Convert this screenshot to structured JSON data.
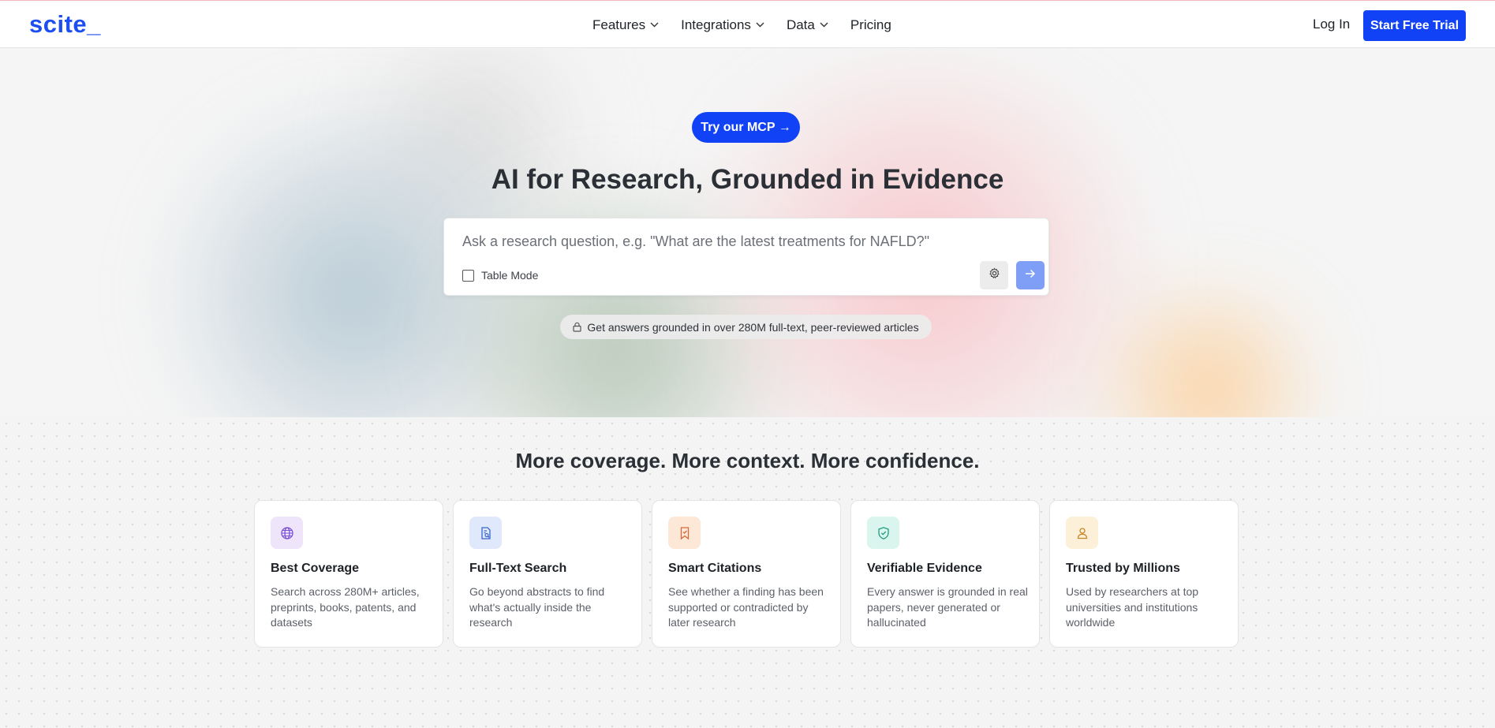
{
  "header": {
    "logo": "scite_",
    "nav": [
      {
        "label": "Features",
        "has_dropdown": true
      },
      {
        "label": "Integrations",
        "has_dropdown": true
      },
      {
        "label": "Data",
        "has_dropdown": true
      },
      {
        "label": "Pricing",
        "has_dropdown": false
      }
    ],
    "login_label": "Log In",
    "trial_label": "Start Free Trial"
  },
  "hero": {
    "mcp_button": "Try our MCP →",
    "title": "AI for Research, Grounded in Evidence",
    "search_placeholder": "Ask a research question, e.g. \"What are the latest treatments for NAFLD?\"",
    "table_mode_label": "Table Mode",
    "table_mode_checked": false,
    "info_pill": "Get answers grounded in over 280M full-text, peer-reviewed articles"
  },
  "features": {
    "title": "More coverage. More context. More confidence.",
    "cards": [
      {
        "icon": "globe-icon",
        "title": "Best Coverage",
        "desc": "Search across 280M+ articles, preprints, books, patents, and datasets",
        "icon_bg": "#efe5fb",
        "icon_color": "#7b4fd6"
      },
      {
        "icon": "document-search-icon",
        "title": "Full-Text Search",
        "desc": "Go beyond abstracts to find what's actually inside the research",
        "icon_bg": "#dfe9fb",
        "icon_color": "#3a66c9"
      },
      {
        "icon": "bookmark-icon",
        "title": "Smart Citations",
        "desc": "See whether a finding has been supported or contradicted by later research",
        "icon_bg": "#fde8d7",
        "icon_color": "#d7693a"
      },
      {
        "icon": "shield-check-icon",
        "title": "Verifiable Evidence",
        "desc": "Every answer is grounded in real papers, never generated or hallucinated",
        "icon_bg": "#d9f5ee",
        "icon_color": "#1f9c7e"
      },
      {
        "icon": "user-icon",
        "title": "Trusted by Millions",
        "desc": "Used by researchers at top universities and institutions worldwide",
        "icon_bg": "#fdf0d8",
        "icon_color": "#c8872a"
      }
    ]
  },
  "colors": {
    "brand_blue": "#1142f5",
    "submit_button": "#7f9ff6"
  }
}
